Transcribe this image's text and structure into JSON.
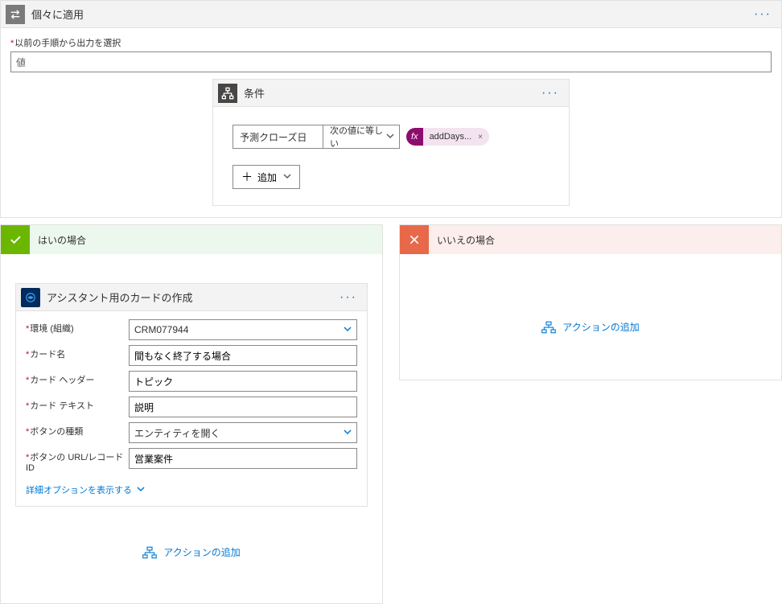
{
  "apply_to_each": {
    "title": "個々に適用",
    "menu": "···",
    "output_label": "以前の手順から出力を選択",
    "output_value": "値"
  },
  "condition": {
    "title": "条件",
    "menu": "···",
    "left_field": "予測クローズ日",
    "operator": "次の値に等しい",
    "expression": {
      "prefix": "fx",
      "label": "addDays..."
    },
    "add_label": "追加"
  },
  "branch_yes": {
    "title": "はいの場合",
    "action": {
      "title": "アシスタント用のカードの作成",
      "menu": "···",
      "fields": {
        "env_label": "環境 (組織)",
        "env_value": "CRM077944",
        "card_name_label": "カード名",
        "card_name_value": "間もなく終了する場合",
        "card_header_label": "カード ヘッダー",
        "card_header_value": "トピック",
        "card_text_label": "カード テキスト",
        "card_text_value": "説明",
        "button_type_label": "ボタンの種類",
        "button_type_value": "エンティティを開く",
        "button_url_label": "ボタンの URL/レコード ID",
        "button_url_value": "営業案件"
      },
      "more_options": "詳細オプションを表示する"
    },
    "add_action": "アクションの追加"
  },
  "branch_no": {
    "title": "いいえの場合",
    "add_action": "アクションの追加"
  }
}
